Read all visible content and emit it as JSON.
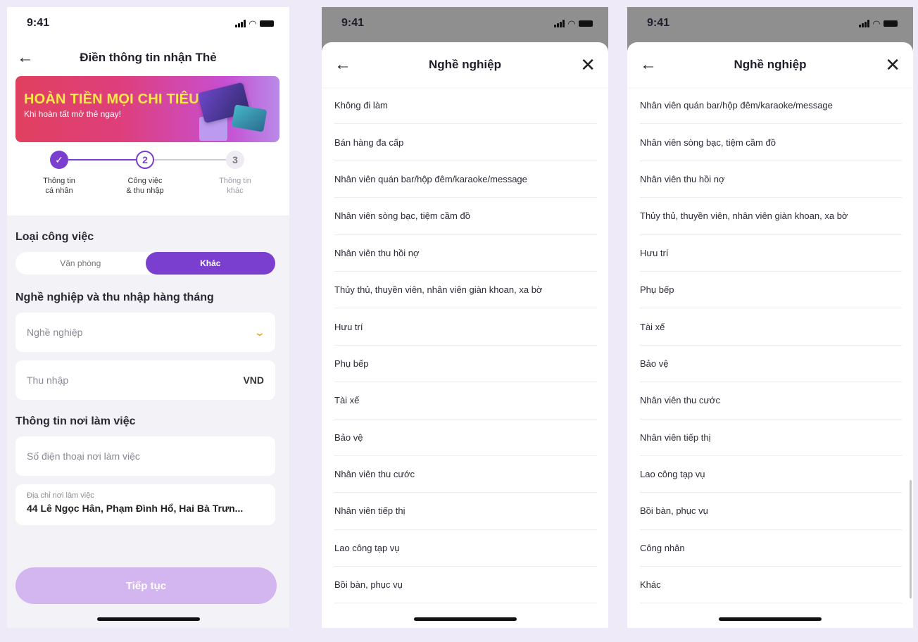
{
  "screen1": {
    "status_time": "9:41",
    "title": "Điền thông tin nhận Thẻ",
    "banner": {
      "headline": "HOÀN TIỀN MỌI CHI TIÊU",
      "subline": "Khi hoàn tất mở thẻ ngay!"
    },
    "steps": [
      {
        "number": "✓",
        "line1": "Thông tin",
        "line2": "cá nhân",
        "state": "done"
      },
      {
        "number": "2",
        "line1": "Công việc",
        "line2": "& thu nhập",
        "state": "active"
      },
      {
        "number": "3",
        "line1": "Thông tin",
        "line2": "khác",
        "state": "todo"
      }
    ],
    "job_type_label": "Loại công việc",
    "job_type_options": [
      "Văn phòng",
      "Khác"
    ],
    "job_type_selected": "Khác",
    "income_section_label": "Nghề nghiệp và thu nhập hàng tháng",
    "occupation_placeholder": "Nghề nghiệp",
    "income_placeholder": "Thu nhập",
    "income_unit": "VND",
    "workplace_section_label": "Thông tin nơi làm việc",
    "work_phone_placeholder": "Số điện thoại nơi làm việc",
    "work_address_label": "Địa chỉ nơi làm việc",
    "work_address_value": "44 Lê Ngọc Hân, Phạm Đình Hổ, Hai Bà Trưn...",
    "continue_label": "Tiếp tục"
  },
  "screen2": {
    "status_time": "9:41",
    "title": "Nghề nghiệp",
    "items": [
      "Không đi làm",
      "Bán hàng đa cấp",
      "Nhân viên quán bar/hộp đêm/karaoke/message",
      "Nhân viên sòng bạc, tiệm cầm đồ",
      "Nhân viên thu hồi nợ",
      "Thủy thủ, thuyền viên, nhân viên giàn khoan, xa bờ",
      "Hưu trí",
      "Phụ bếp",
      "Tài xế",
      "Bảo vệ",
      "Nhân viên thu cước",
      "Nhân viên tiếp thị",
      "Lao công tạp vụ",
      "Bồi bàn, phục vụ"
    ]
  },
  "screen3": {
    "status_time": "9:41",
    "title": "Nghề nghiệp",
    "items": [
      "Nhân viên quán bar/hộp đêm/karaoke/message",
      "Nhân viên sòng bạc, tiệm cầm đồ",
      "Nhân viên thu hồi nợ",
      "Thủy thủ, thuyền viên, nhân viên giàn khoan, xa bờ",
      "Hưu trí",
      "Phụ bếp",
      "Tài xế",
      "Bảo vệ",
      "Nhân viên thu cước",
      "Nhân viên tiếp thị",
      "Lao công tạp vụ",
      "Bồi bàn, phục vụ",
      "Công nhân",
      "Khác"
    ]
  },
  "colors": {
    "primary": "#7b3fd0",
    "disabled_button": "#d3b5ef",
    "background": "#efeaf8",
    "chevron": "#e7a53a"
  }
}
